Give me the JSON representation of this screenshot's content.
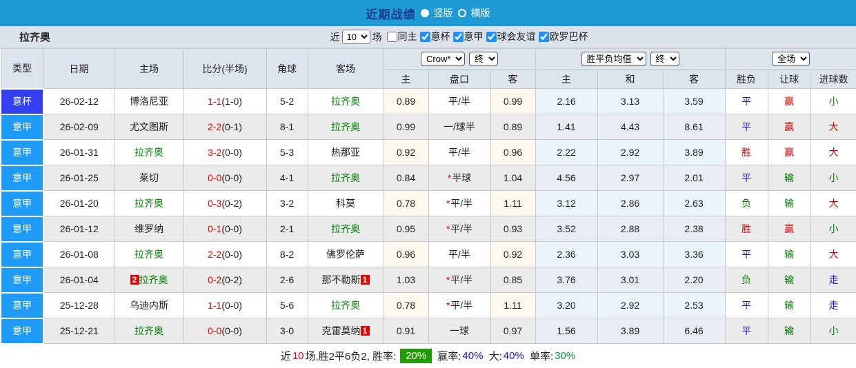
{
  "topbar": {
    "title": "近期战绩",
    "radio_vertical": "竖版",
    "radio_horizontal": "横版",
    "bar_color": "#1e9ad5"
  },
  "filterbar": {
    "team": "拉齐奥",
    "recent_label": "近",
    "recent_value": "10",
    "games_label": "场",
    "checkboxes": [
      {
        "label": "同主",
        "checked": false
      },
      {
        "label": "意杯",
        "checked": true
      },
      {
        "label": "意甲",
        "checked": true
      },
      {
        "label": "球会友谊",
        "checked": true
      },
      {
        "label": "欧罗巴杯",
        "checked": true
      }
    ]
  },
  "table": {
    "static_headers": [
      "类型",
      "日期",
      "主场",
      "比分(半场)",
      "角球",
      "客场"
    ],
    "group1": {
      "select1": "Crow*",
      "select2": "终",
      "cols": [
        "主",
        "盘口",
        "客"
      ]
    },
    "group2": {
      "select1": "胜平负均值",
      "select2": "终",
      "cols": [
        "主",
        "和",
        "客"
      ]
    },
    "group3": {
      "select1": "全场",
      "cols": [
        "胜负",
        "让球",
        "进球数"
      ]
    },
    "rows": [
      {
        "type": "意杯",
        "type_color": "#3240ef",
        "date": "26-02-12",
        "home": "博洛尼亚",
        "home_focus": false,
        "home_rank": "",
        "score": "1-1",
        "half": "(1-0)",
        "corners": "5-2",
        "away": "拉齐奥",
        "away_focus": true,
        "away_rank": "",
        "odds_home": "0.89",
        "handicap_star": false,
        "handicap": "平/半",
        "odds_away": "0.99",
        "mean_home": "2.16",
        "mean_draw": "3.13",
        "mean_away": "3.59",
        "result": "平",
        "handicap_result": "赢",
        "goals": "小"
      },
      {
        "type": "意甲",
        "type_color": "#1e9bf7",
        "date": "26-02-09",
        "home": "尤文图斯",
        "home_focus": false,
        "home_rank": "",
        "score": "2-2",
        "half": "(0-1)",
        "corners": "8-1",
        "away": "拉齐奥",
        "away_focus": true,
        "away_rank": "",
        "odds_home": "0.99",
        "handicap_star": false,
        "handicap": "一/球半",
        "odds_away": "0.89",
        "mean_home": "1.41",
        "mean_draw": "4.43",
        "mean_away": "8.61",
        "result": "平",
        "handicap_result": "赢",
        "goals": "大"
      },
      {
        "type": "意甲",
        "type_color": "#1e9bf7",
        "date": "26-01-31",
        "home": "拉齐奥",
        "home_focus": true,
        "home_rank": "",
        "score": "3-2",
        "half": "(0-0)",
        "corners": "5-3",
        "away": "热那亚",
        "away_focus": false,
        "away_rank": "",
        "odds_home": "0.92",
        "handicap_star": false,
        "handicap": "平/半",
        "odds_away": "0.96",
        "mean_home": "2.22",
        "mean_draw": "2.92",
        "mean_away": "3.89",
        "result": "胜",
        "handicap_result": "赢",
        "goals": "大"
      },
      {
        "type": "意甲",
        "type_color": "#1e9bf7",
        "date": "26-01-25",
        "home": "莱切",
        "home_focus": false,
        "home_rank": "",
        "score": "0-0",
        "half": "(0-0)",
        "corners": "4-1",
        "away": "拉齐奥",
        "away_focus": true,
        "away_rank": "",
        "odds_home": "0.84",
        "handicap_star": true,
        "handicap": "半球",
        "odds_away": "1.04",
        "mean_home": "4.56",
        "mean_draw": "2.97",
        "mean_away": "2.01",
        "result": "平",
        "handicap_result": "输",
        "goals": "小"
      },
      {
        "type": "意甲",
        "type_color": "#1e9bf7",
        "date": "26-01-20",
        "home": "拉齐奥",
        "home_focus": true,
        "home_rank": "",
        "score": "0-3",
        "half": "(0-2)",
        "corners": "3-2",
        "away": "科莫",
        "away_focus": false,
        "away_rank": "",
        "odds_home": "0.78",
        "handicap_star": true,
        "handicap": "平/半",
        "odds_away": "1.11",
        "mean_home": "3.12",
        "mean_draw": "2.86",
        "mean_away": "2.63",
        "result": "负",
        "handicap_result": "输",
        "goals": "大"
      },
      {
        "type": "意甲",
        "type_color": "#1e9bf7",
        "date": "26-01-12",
        "home": "维罗纳",
        "home_focus": false,
        "home_rank": "",
        "score": "0-1",
        "half": "(0-0)",
        "corners": "2-1",
        "away": "拉齐奥",
        "away_focus": true,
        "away_rank": "",
        "odds_home": "0.95",
        "handicap_star": true,
        "handicap": "平/半",
        "odds_away": "0.93",
        "mean_home": "3.52",
        "mean_draw": "2.88",
        "mean_away": "2.38",
        "result": "胜",
        "handicap_result": "赢",
        "goals": "小"
      },
      {
        "type": "意甲",
        "type_color": "#1e9bf7",
        "date": "26-01-08",
        "home": "拉齐奥",
        "home_focus": true,
        "home_rank": "",
        "score": "2-2",
        "half": "(0-0)",
        "corners": "8-2",
        "away": "佛罗伦萨",
        "away_focus": false,
        "away_rank": "",
        "odds_home": "0.96",
        "handicap_star": false,
        "handicap": "平/半",
        "odds_away": "0.92",
        "mean_home": "2.36",
        "mean_draw": "3.03",
        "mean_away": "3.36",
        "result": "平",
        "handicap_result": "输",
        "goals": "大"
      },
      {
        "type": "意甲",
        "type_color": "#1e9bf7",
        "date": "26-01-04",
        "home": "拉齐奥",
        "home_focus": true,
        "home_rank": "2",
        "score": "0-2",
        "half": "(0-2)",
        "corners": "2-6",
        "away": "那不勒斯",
        "away_focus": false,
        "away_rank": "1",
        "odds_home": "1.03",
        "handicap_star": true,
        "handicap": "平/半",
        "odds_away": "0.85",
        "mean_home": "3.76",
        "mean_draw": "3.01",
        "mean_away": "2.20",
        "result": "负",
        "handicap_result": "输",
        "goals": "走"
      },
      {
        "type": "意甲",
        "type_color": "#1e9bf7",
        "date": "25-12-28",
        "home": "乌迪内斯",
        "home_focus": false,
        "home_rank": "",
        "score": "1-1",
        "half": "(0-0)",
        "corners": "5-6",
        "away": "拉齐奥",
        "away_focus": true,
        "away_rank": "",
        "odds_home": "0.78",
        "handicap_star": true,
        "handicap": "平/半",
        "odds_away": "1.11",
        "mean_home": "3.20",
        "mean_draw": "2.92",
        "mean_away": "2.53",
        "result": "平",
        "handicap_result": "输",
        "goals": "走"
      },
      {
        "type": "意甲",
        "type_color": "#1e9bf7",
        "date": "25-12-21",
        "home": "拉齐奥",
        "home_focus": true,
        "home_rank": "",
        "score": "0-0",
        "half": "(0-0)",
        "corners": "3-0",
        "away": "克雷莫纳",
        "away_focus": false,
        "away_rank": "1",
        "odds_home": "0.91",
        "handicap_star": false,
        "handicap": "一球",
        "odds_away": "0.97",
        "mean_home": "1.56",
        "mean_draw": "3.89",
        "mean_away": "6.46",
        "result": "平",
        "handicap_result": "输",
        "goals": "小"
      }
    ]
  },
  "footer": {
    "prefix": "近",
    "count": "10",
    "summary": "场,胜2平6负2, 胜率:",
    "win_rate": "20%",
    "win_label": "赢率:",
    "win_value": "40%",
    "big_label": "大:",
    "big_value": "40%",
    "single_label": "单率:",
    "single_value": "30%"
  },
  "colors": {
    "focus_team": "#008000",
    "score": "#e60000",
    "rank_badge_bg": "#e60000",
    "win_rate_bg": "#1f9d00",
    "value_colors": {
      "胜": "#cc0000",
      "平": "#1414cc",
      "负": "#008000",
      "赢": "#cc0000",
      "输": "#008000",
      "走": "#1414cc",
      "大": "#cc0000",
      "小": "#008000"
    }
  }
}
